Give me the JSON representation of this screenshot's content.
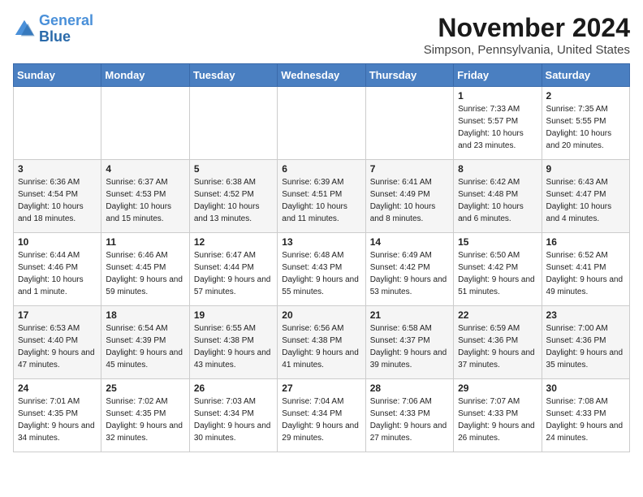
{
  "header": {
    "logo_line1": "General",
    "logo_line2": "Blue",
    "month": "November 2024",
    "location": "Simpson, Pennsylvania, United States"
  },
  "weekdays": [
    "Sunday",
    "Monday",
    "Tuesday",
    "Wednesday",
    "Thursday",
    "Friday",
    "Saturday"
  ],
  "weeks": [
    [
      {
        "day": "",
        "sunrise": "",
        "sunset": "",
        "daylight": ""
      },
      {
        "day": "",
        "sunrise": "",
        "sunset": "",
        "daylight": ""
      },
      {
        "day": "",
        "sunrise": "",
        "sunset": "",
        "daylight": ""
      },
      {
        "day": "",
        "sunrise": "",
        "sunset": "",
        "daylight": ""
      },
      {
        "day": "",
        "sunrise": "",
        "sunset": "",
        "daylight": ""
      },
      {
        "day": "1",
        "sunrise": "Sunrise: 7:33 AM",
        "sunset": "Sunset: 5:57 PM",
        "daylight": "Daylight: 10 hours and 23 minutes."
      },
      {
        "day": "2",
        "sunrise": "Sunrise: 7:35 AM",
        "sunset": "Sunset: 5:55 PM",
        "daylight": "Daylight: 10 hours and 20 minutes."
      }
    ],
    [
      {
        "day": "3",
        "sunrise": "Sunrise: 6:36 AM",
        "sunset": "Sunset: 4:54 PM",
        "daylight": "Daylight: 10 hours and 18 minutes."
      },
      {
        "day": "4",
        "sunrise": "Sunrise: 6:37 AM",
        "sunset": "Sunset: 4:53 PM",
        "daylight": "Daylight: 10 hours and 15 minutes."
      },
      {
        "day": "5",
        "sunrise": "Sunrise: 6:38 AM",
        "sunset": "Sunset: 4:52 PM",
        "daylight": "Daylight: 10 hours and 13 minutes."
      },
      {
        "day": "6",
        "sunrise": "Sunrise: 6:39 AM",
        "sunset": "Sunset: 4:51 PM",
        "daylight": "Daylight: 10 hours and 11 minutes."
      },
      {
        "day": "7",
        "sunrise": "Sunrise: 6:41 AM",
        "sunset": "Sunset: 4:49 PM",
        "daylight": "Daylight: 10 hours and 8 minutes."
      },
      {
        "day": "8",
        "sunrise": "Sunrise: 6:42 AM",
        "sunset": "Sunset: 4:48 PM",
        "daylight": "Daylight: 10 hours and 6 minutes."
      },
      {
        "day": "9",
        "sunrise": "Sunrise: 6:43 AM",
        "sunset": "Sunset: 4:47 PM",
        "daylight": "Daylight: 10 hours and 4 minutes."
      }
    ],
    [
      {
        "day": "10",
        "sunrise": "Sunrise: 6:44 AM",
        "sunset": "Sunset: 4:46 PM",
        "daylight": "Daylight: 10 hours and 1 minute."
      },
      {
        "day": "11",
        "sunrise": "Sunrise: 6:46 AM",
        "sunset": "Sunset: 4:45 PM",
        "daylight": "Daylight: 9 hours and 59 minutes."
      },
      {
        "day": "12",
        "sunrise": "Sunrise: 6:47 AM",
        "sunset": "Sunset: 4:44 PM",
        "daylight": "Daylight: 9 hours and 57 minutes."
      },
      {
        "day": "13",
        "sunrise": "Sunrise: 6:48 AM",
        "sunset": "Sunset: 4:43 PM",
        "daylight": "Daylight: 9 hours and 55 minutes."
      },
      {
        "day": "14",
        "sunrise": "Sunrise: 6:49 AM",
        "sunset": "Sunset: 4:42 PM",
        "daylight": "Daylight: 9 hours and 53 minutes."
      },
      {
        "day": "15",
        "sunrise": "Sunrise: 6:50 AM",
        "sunset": "Sunset: 4:42 PM",
        "daylight": "Daylight: 9 hours and 51 minutes."
      },
      {
        "day": "16",
        "sunrise": "Sunrise: 6:52 AM",
        "sunset": "Sunset: 4:41 PM",
        "daylight": "Daylight: 9 hours and 49 minutes."
      }
    ],
    [
      {
        "day": "17",
        "sunrise": "Sunrise: 6:53 AM",
        "sunset": "Sunset: 4:40 PM",
        "daylight": "Daylight: 9 hours and 47 minutes."
      },
      {
        "day": "18",
        "sunrise": "Sunrise: 6:54 AM",
        "sunset": "Sunset: 4:39 PM",
        "daylight": "Daylight: 9 hours and 45 minutes."
      },
      {
        "day": "19",
        "sunrise": "Sunrise: 6:55 AM",
        "sunset": "Sunset: 4:38 PM",
        "daylight": "Daylight: 9 hours and 43 minutes."
      },
      {
        "day": "20",
        "sunrise": "Sunrise: 6:56 AM",
        "sunset": "Sunset: 4:38 PM",
        "daylight": "Daylight: 9 hours and 41 minutes."
      },
      {
        "day": "21",
        "sunrise": "Sunrise: 6:58 AM",
        "sunset": "Sunset: 4:37 PM",
        "daylight": "Daylight: 9 hours and 39 minutes."
      },
      {
        "day": "22",
        "sunrise": "Sunrise: 6:59 AM",
        "sunset": "Sunset: 4:36 PM",
        "daylight": "Daylight: 9 hours and 37 minutes."
      },
      {
        "day": "23",
        "sunrise": "Sunrise: 7:00 AM",
        "sunset": "Sunset: 4:36 PM",
        "daylight": "Daylight: 9 hours and 35 minutes."
      }
    ],
    [
      {
        "day": "24",
        "sunrise": "Sunrise: 7:01 AM",
        "sunset": "Sunset: 4:35 PM",
        "daylight": "Daylight: 9 hours and 34 minutes."
      },
      {
        "day": "25",
        "sunrise": "Sunrise: 7:02 AM",
        "sunset": "Sunset: 4:35 PM",
        "daylight": "Daylight: 9 hours and 32 minutes."
      },
      {
        "day": "26",
        "sunrise": "Sunrise: 7:03 AM",
        "sunset": "Sunset: 4:34 PM",
        "daylight": "Daylight: 9 hours and 30 minutes."
      },
      {
        "day": "27",
        "sunrise": "Sunrise: 7:04 AM",
        "sunset": "Sunset: 4:34 PM",
        "daylight": "Daylight: 9 hours and 29 minutes."
      },
      {
        "day": "28",
        "sunrise": "Sunrise: 7:06 AM",
        "sunset": "Sunset: 4:33 PM",
        "daylight": "Daylight: 9 hours and 27 minutes."
      },
      {
        "day": "29",
        "sunrise": "Sunrise: 7:07 AM",
        "sunset": "Sunset: 4:33 PM",
        "daylight": "Daylight: 9 hours and 26 minutes."
      },
      {
        "day": "30",
        "sunrise": "Sunrise: 7:08 AM",
        "sunset": "Sunset: 4:33 PM",
        "daylight": "Daylight: 9 hours and 24 minutes."
      }
    ]
  ]
}
